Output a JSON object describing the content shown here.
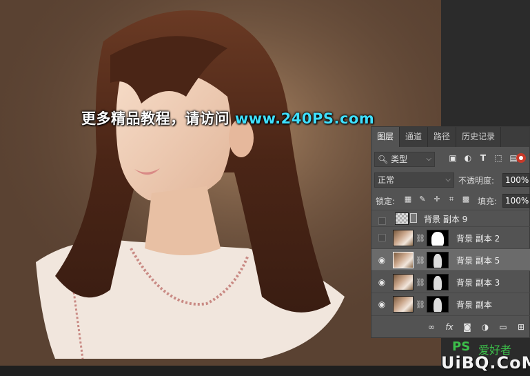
{
  "watermark": {
    "text": "更多精品教程，请访问",
    "url": "www.240PS.com"
  },
  "tabs": [
    {
      "label": "图层",
      "active": true
    },
    {
      "label": "通道",
      "active": false
    },
    {
      "label": "路径",
      "active": false
    },
    {
      "label": "历史记录",
      "active": false
    }
  ],
  "filter": {
    "select_label": "类型",
    "icons": [
      "image-filter-icon",
      "adjustment-filter-icon",
      "type-filter-icon",
      "shape-filter-icon",
      "smart-object-filter-icon"
    ]
  },
  "blend": {
    "mode": "正常",
    "opacity_label": "不透明度:",
    "opacity_value": "100%"
  },
  "lock": {
    "label": "锁定:",
    "fill_label": "填充:",
    "fill_value": "100%"
  },
  "layers": [
    {
      "name": "背景 副本 9",
      "visible": false,
      "selected": false,
      "has_mask": false
    },
    {
      "name": "背景 副本 2",
      "visible": false,
      "selected": false,
      "has_mask": true
    },
    {
      "name": "背景 副本 5",
      "visible": true,
      "selected": true,
      "has_mask": true
    },
    {
      "name": "背景 副本 3",
      "visible": true,
      "selected": false,
      "has_mask": true
    },
    {
      "name": "背景 副本",
      "visible": true,
      "selected": false,
      "has_mask": true
    }
  ],
  "bottom_tools": [
    "link-icon",
    "fx-icon",
    "mask-icon",
    "adjustment-icon",
    "folder-icon",
    "new-layer-icon"
  ],
  "logo": {
    "ps": "PS",
    "cn": "爱好者",
    "url": "UiBQ.CoM"
  },
  "colors": {
    "canvas_bg": "#5a4232",
    "panel_bg": "#535353",
    "url_cyan": "#3fe0ff",
    "logo_green": "#3cbf4a"
  }
}
